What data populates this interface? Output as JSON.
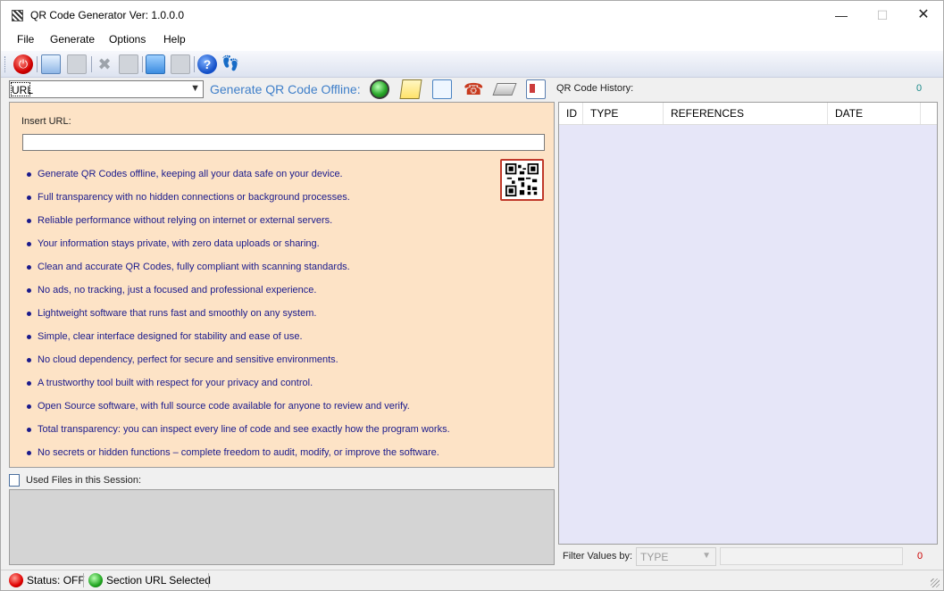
{
  "window": {
    "title": "QR Code Generator Ver: 1.0.0.0",
    "controls": {
      "minimize": "—",
      "maximize": "☐",
      "close": "✕"
    }
  },
  "menu": [
    "File",
    "Generate",
    "Options",
    "Help"
  ],
  "toolbar": {
    "icons": [
      "power-icon",
      "edit-icon",
      "save-icon",
      "delete-icon",
      "print-icon",
      "open-folder-icon",
      "export-icon",
      "help-icon",
      "footprints-icon"
    ]
  },
  "type_select": {
    "value": "URL"
  },
  "generate": {
    "label": "Generate QR Code Offline:",
    "icons": [
      "globe-icon",
      "note-icon",
      "email-icon",
      "phone-icon",
      "card-icon",
      "vcard-icon"
    ]
  },
  "url_panel": {
    "insert_label": "Insert URL:",
    "url_value": "",
    "features": [
      "Generate QR Codes offline, keeping all your data safe on your device.",
      "Full transparency with no hidden connections or background processes.",
      "Reliable performance without relying on internet or external servers.",
      "Your information stays private, with zero data uploads or sharing.",
      "Clean and accurate QR Codes, fully compliant with scanning standards.",
      "No ads, no tracking, just a focused and professional experience.",
      "Lightweight software that runs fast and smoothly on any system.",
      "Simple, clear interface designed for stability and ease of use.",
      "No cloud dependency, perfect for secure and sensitive environments.",
      "A trustworthy tool built with respect for your privacy and control.",
      "Open Source software, with full source code available for anyone to review and verify.",
      "Total transparency: you can inspect every line of code and see exactly how the program works.",
      "No secrets or hidden functions – complete freedom to audit, modify, or improve the software."
    ]
  },
  "used_files": {
    "label": "Used Files in this Session:"
  },
  "history": {
    "label": "QR Code History:",
    "count": "0",
    "columns": [
      "ID",
      "TYPE",
      "REFERENCES",
      "DATE"
    ],
    "rows": []
  },
  "filter": {
    "label": "Filter Values by:",
    "select_value": "TYPE",
    "text_value": "",
    "count": "0"
  },
  "status": {
    "left": "Status: OFF",
    "right": "Section URL Selected"
  },
  "colors": {
    "panel_bg": "#fde3c6",
    "feature_text": "#1a1a8c",
    "generate_label": "#3f7fc9",
    "history_bg": "#e6e6f8",
    "history_count": "#1b8a8a",
    "filter_count": "#cc0000"
  }
}
